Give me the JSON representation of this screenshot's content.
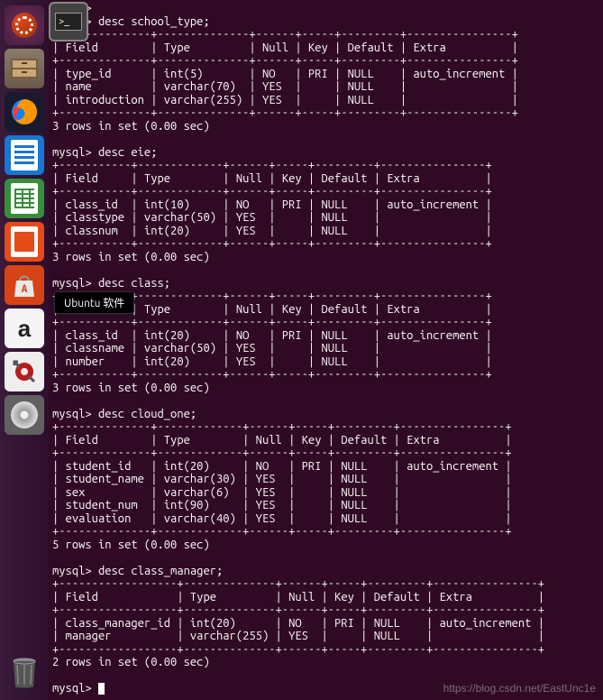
{
  "tooltip": "Ubuntu 软件",
  "watermark": "https://blog.csdn.net/EastUnc1e",
  "launcher": {
    "items": [
      {
        "name": "ubuntu-dash",
        "label": "Dash"
      },
      {
        "name": "files",
        "label": "Files"
      },
      {
        "name": "firefox",
        "label": "Firefox"
      },
      {
        "name": "writer",
        "label": "LibreOffice Writer"
      },
      {
        "name": "calc",
        "label": "LibreOffice Calc"
      },
      {
        "name": "impress",
        "label": "LibreOffice Impress"
      },
      {
        "name": "software",
        "label": "Ubuntu Software"
      },
      {
        "name": "amazon",
        "label": "Amazon"
      },
      {
        "name": "settings",
        "label": "System Settings"
      },
      {
        "name": "terminal",
        "label": "Terminal"
      },
      {
        "name": "disk",
        "label": "Disk"
      }
    ],
    "trash": "Trash"
  },
  "terminal_lines": [
    "mysql>",
    "mysql> desc school_type;",
    "+--------------+--------------+------+-----+---------+----------------+",
    "| Field        | Type         | Null | Key | Default | Extra          |",
    "+--------------+--------------+------+-----+---------+----------------+",
    "| type_id      | int(5)       | NO   | PRI | NULL    | auto_increment |",
    "| name         | varchar(70)  | YES  |     | NULL    |                |",
    "| introduction | varchar(255) | YES  |     | NULL    |                |",
    "+--------------+--------------+------+-----+---------+----------------+",
    "3 rows in set (0.00 sec)",
    "",
    "mysql> desc eie;",
    "+-----------+-------------+------+-----+---------+----------------+",
    "| Field     | Type        | Null | Key | Default | Extra          |",
    "+-----------+-------------+------+-----+---------+----------------+",
    "| class_id  | int(10)     | NO   | PRI | NULL    | auto_increment |",
    "| classtype | varchar(50) | YES  |     | NULL    |                |",
    "| classnum  | int(20)     | YES  |     | NULL    |                |",
    "+-----------+-------------+------+-----+---------+----------------+",
    "3 rows in set (0.00 sec)",
    "",
    "mysql> desc class;",
    "+-----------+-------------+------+-----+---------+----------------+",
    "| Field     | Type        | Null | Key | Default | Extra          |",
    "+-----------+-------------+------+-----+---------+----------------+",
    "| class_id  | int(20)     | NO   | PRI | NULL    | auto_increment |",
    "| classname | varchar(50) | YES  |     | NULL    |                |",
    "| number    | int(20)     | YES  |     | NULL    |                |",
    "+-----------+-------------+------+-----+---------+----------------+",
    "3 rows in set (0.00 sec)",
    "",
    "mysql> desc cloud_one;",
    "+--------------+-------------+------+-----+---------+----------------+",
    "| Field        | Type        | Null | Key | Default | Extra          |",
    "+--------------+-------------+------+-----+---------+----------------+",
    "| student_id   | int(20)     | NO   | PRI | NULL    | auto_increment |",
    "| student_name | varchar(30) | YES  |     | NULL    |                |",
    "| sex          | varchar(6)  | YES  |     | NULL    |                |",
    "| student_num  | int(90)     | YES  |     | NULL    |                |",
    "| evaluation   | varchar(40) | YES  |     | NULL    |                |",
    "+--------------+-------------+------+-----+---------+----------------+",
    "5 rows in set (0.00 sec)",
    "",
    "mysql> desc class_manager;",
    "+------------------+--------------+------+-----+---------+----------------+",
    "| Field            | Type         | Null | Key | Default | Extra          |",
    "+------------------+--------------+------+-----+---------+----------------+",
    "| class_manager_id | int(20)      | NO   | PRI | NULL    | auto_increment |",
    "| manager          | varchar(255) | YES  |     | NULL    |                |",
    "+------------------+--------------+------+-----+---------+----------------+",
    "2 rows in set (0.00 sec)",
    "",
    "mysql> "
  ]
}
